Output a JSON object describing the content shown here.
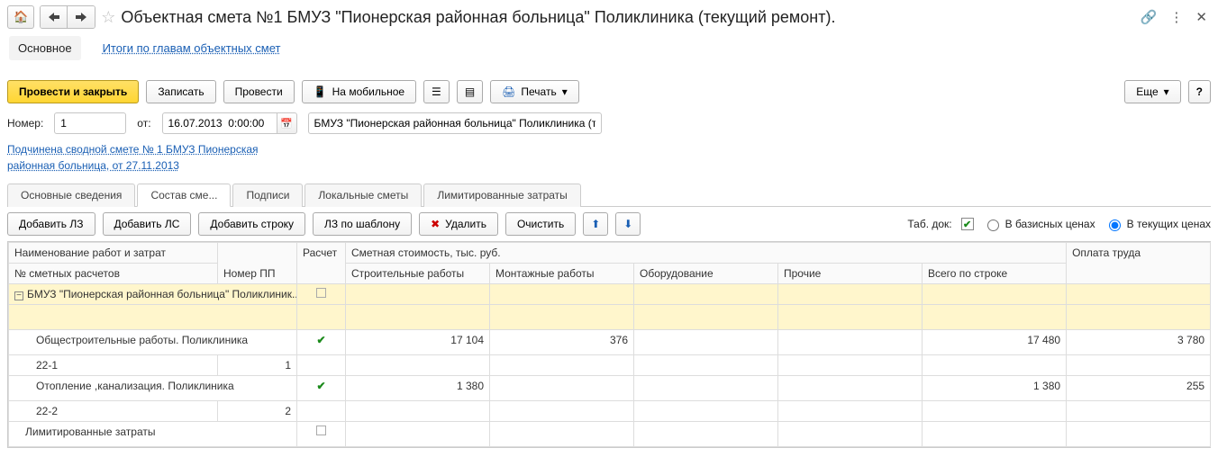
{
  "header": {
    "title": "Объектная смета №1 БМУЗ \"Пионерская районная больница\" Поликлиника (текущий ремонт)."
  },
  "sect_tabs": {
    "main": "Основное",
    "totals": "Итоги по главам объектных смет"
  },
  "toolbar": {
    "post_close": "Провести и закрыть",
    "save": "Записать",
    "post": "Провести",
    "mobile": "На мобильное",
    "print": "Печать",
    "more": "Еще",
    "help": "?"
  },
  "fields": {
    "number_label": "Номер:",
    "number_value": "1",
    "from_label": "от:",
    "date_value": "16.07.2013  0:00:00",
    "object_value": "БМУЗ \"Пионерская районная больница\" Поликлиника (текущий"
  },
  "parent_link": "Подчинена сводной смете № 1 БМУЗ  Пионерская районная больница, от 27.11.2013",
  "tabs": [
    "Основные сведения",
    "Состав сме...",
    "Подписи",
    "Локальные сметы",
    "Лимитированные затраты"
  ],
  "mini_toolbar": {
    "add_lz": "Добавить ЛЗ",
    "add_ls": "Добавить ЛС",
    "add_row": "Добавить строку",
    "lz_tpl": "ЛЗ по шаблону",
    "delete": "Удалить",
    "clear": "Очистить",
    "tab_doc": "Таб. док:",
    "base_prices": "В базисных ценах",
    "curr_prices": "В текущих ценах"
  },
  "table": {
    "hdr_name": "Наименование работ и затрат",
    "hdr_num": "№ сметных расчетов",
    "hdr_pp": "Номер ПП",
    "hdr_calc": "Расчет",
    "hdr_cost_group": "Сметная стоимость, тыс. руб.",
    "hdr_build": "Строительные работы",
    "hdr_mount": "Монтажные работы",
    "hdr_equip": "Оборудование",
    "hdr_other": "Прочие",
    "hdr_total": "Всего по строке",
    "hdr_labor": "Оплата труда",
    "group_row": {
      "name": "БМУЗ \"Пионерская районная больница\" Поликлиник..."
    },
    "row1": {
      "name": "Общестроительные работы. Поликлиника",
      "num": "22-1",
      "pp": "1",
      "build": "17 104",
      "mount": "376",
      "total": "17 480",
      "labor": "3 780"
    },
    "row2": {
      "name": "Отопление ,канализация. Поликлиника",
      "num": "22-2",
      "pp": "2",
      "build": "1 380",
      "total": "1 380",
      "labor": "255"
    },
    "row3": {
      "name": "Лимитированные затраты"
    }
  }
}
